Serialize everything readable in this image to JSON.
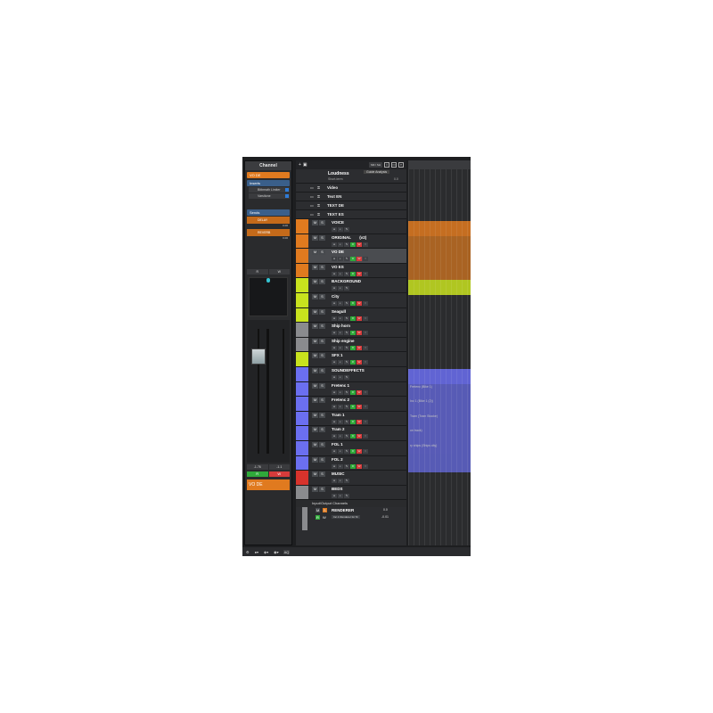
{
  "inspector": {
    "tab": "Channel",
    "channel_name": "VO DE",
    "inserts_label": "Inserts",
    "inserts": [
      "Bitbreath Limiter",
      "Varsitone"
    ],
    "sends_label": "Sends",
    "sends": [
      {
        "name": "DELAY",
        "val": "0.00"
      },
      {
        "name": "REVERB",
        "val": "0.00"
      }
    ],
    "mini": [
      "R",
      "W"
    ],
    "mini2": [
      "-1.76",
      "-1.1"
    ],
    "footer_name": "VO DE"
  },
  "tracks": {
    "toolbar": {
      "pill": "SM / SH"
    },
    "loudness": {
      "name": "Loudness",
      "btn": "Guide Analysis",
      "sub": "Short-term",
      "val": "0.0"
    },
    "headers": [
      {
        "name": "Video"
      },
      {
        "name": "Text EN"
      },
      {
        "name": "TEXT DE"
      },
      {
        "name": "TEXT ES"
      }
    ],
    "list": [
      {
        "name": "VOICE",
        "color": "#e07a1f"
      },
      {
        "name": "ORIGINAL",
        "extra": "(v2)",
        "color": "#e07a1f"
      },
      {
        "name": "VO DE",
        "color": "#e07a1f",
        "sel": true
      },
      {
        "name": "VO ES",
        "color": "#e07a1f"
      },
      {
        "name": "BACKGROUND",
        "color": "#c8e21e"
      },
      {
        "name": "City",
        "color": "#c8e21e"
      },
      {
        "name": "Seagull",
        "color": "#c8e21e"
      },
      {
        "name": "Ship horn",
        "color": "#8a8b8e"
      },
      {
        "name": "Ship engine",
        "color": "#8a8b8e"
      },
      {
        "name": "SFX 1",
        "color": "#c8e21e"
      },
      {
        "name": "SOUNDEFFECTS",
        "color": "#6b6ff0"
      },
      {
        "name": "Fretenc 1",
        "color": "#6b6ff0"
      },
      {
        "name": "Fretenc 2",
        "color": "#6b6ff0"
      },
      {
        "name": "Tram 1",
        "color": "#6b6ff0"
      },
      {
        "name": "Tram 2",
        "color": "#6b6ff0"
      },
      {
        "name": "FOL 1",
        "color": "#6b6ff0"
      },
      {
        "name": "FOL 2",
        "color": "#6b6ff0"
      },
      {
        "name": "MUSIC",
        "color": "#d7332c"
      },
      {
        "name": "BEDS",
        "color": "#8a8b8e"
      }
    ],
    "io_label": "Input/Output Channels",
    "renderer": {
      "name": "RENDERER",
      "val": "0.0",
      "sub": "Inc.1 Renderer for M",
      "db": "-0.01"
    }
  },
  "arrangement": {
    "labels": [
      "Fretenc (Bike 1)",
      "Inc 1 (Bike 1 (2))",
      "Tram (Tram Stocke)",
      "on track)",
      "ry ships (Ships city)"
    ]
  },
  "bottom": {
    "items": [
      "⚙",
      "●▾",
      "◈▾",
      "◉▾",
      "AQ"
    ]
  }
}
